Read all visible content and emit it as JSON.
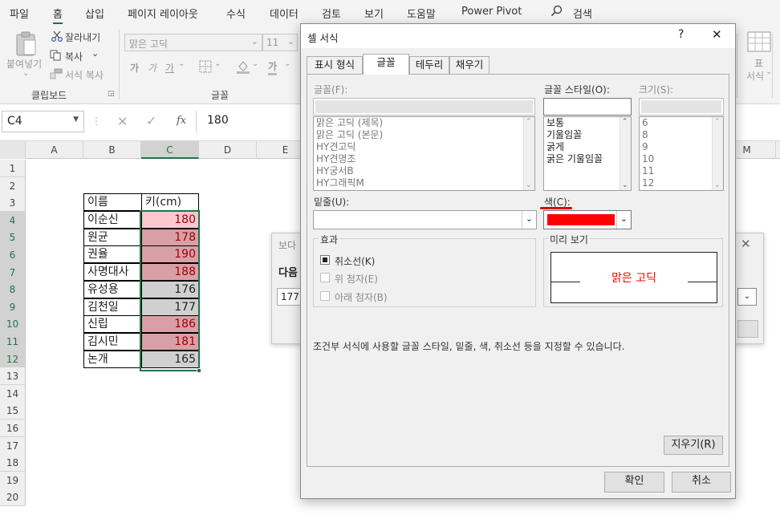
{
  "menu": {
    "items": [
      "파일",
      "홈",
      "삽입",
      "페이지 레이아웃",
      "수식",
      "데이터",
      "검토",
      "보기",
      "도움말",
      "Power Pivot"
    ],
    "search_label": "검색"
  },
  "ribbon": {
    "clipboard": {
      "paste": "붙여넣기",
      "cut": "잘라내기",
      "copy": "복사",
      "format_painter": "서식 복사",
      "group_label": "클립보드"
    },
    "font": {
      "font_name": "맑은 고딕",
      "font_size": "11",
      "bold": "가",
      "italic": "가",
      "underline": "가",
      "font_color": "가",
      "group_label": "글꼴"
    },
    "right": {
      "label1": "표",
      "label2": "서식"
    }
  },
  "formula_bar": {
    "name_box": "C4",
    "fx": "fx",
    "value": "180"
  },
  "grid": {
    "columns": [
      "A",
      "B",
      "C",
      "D",
      "E",
      "M"
    ],
    "rows": [
      "1",
      "2",
      "3",
      "4",
      "5",
      "6",
      "7",
      "8",
      "9",
      "10",
      "11",
      "12",
      "13",
      "14",
      "15",
      "16",
      "17",
      "18",
      "19",
      "20"
    ],
    "header": {
      "name": "이름",
      "height": "키(cm)"
    },
    "data": [
      {
        "name": "이순신",
        "height": "180",
        "hl": "#ffc7ce"
      },
      {
        "name": "원균",
        "height": "178",
        "hl": "#d8a0a6"
      },
      {
        "name": "권율",
        "height": "190",
        "hl": "#d8a0a6"
      },
      {
        "name": "사명대사",
        "height": "188",
        "hl": "#d8a0a6"
      },
      {
        "name": "유성용",
        "height": "176",
        "hl": "#d0d0d0"
      },
      {
        "name": "김천일",
        "height": "177",
        "hl": "#d0d0d0"
      },
      {
        "name": "신립",
        "height": "186",
        "hl": "#d8a0a6"
      },
      {
        "name": "김시민",
        "height": "181",
        "hl": "#d8a0a6"
      },
      {
        "name": "논개",
        "height": "165",
        "hl": "#d0d0d0"
      }
    ]
  },
  "bg_dialog": {
    "title": "보다",
    "prompt": "다음",
    "value": "177."
  },
  "dialog": {
    "title": "셀 서식",
    "help": "?",
    "close": "✕",
    "tabs": [
      "표시 형식",
      "글꼴",
      "테두리",
      "채우기"
    ],
    "font_label": "글꼴(F):",
    "fonts": [
      "맑은 고딕 (제목)",
      "맑은 고딕 (본문)",
      "HY견고딕",
      "HY견명조",
      "HY궁서B",
      "HY그래픽M"
    ],
    "style_label": "글꼴 스타일(O):",
    "styles": [
      "보통",
      "기울임꼴",
      "굵게",
      "굵은 기울임꼴"
    ],
    "size_label": "크기(S):",
    "sizes": [
      "6",
      "8",
      "9",
      "10",
      "11",
      "12"
    ],
    "underline_label": "밑줄(U):",
    "color_label": "색(C):",
    "color_value": "#ff0000",
    "effects_label": "효과",
    "strikethrough": "취소선(K)",
    "superscript": "위 첨자(E)",
    "subscript": "아래 첨자(B)",
    "preview_label": "미리 보기",
    "preview_text": "맑은 고딕",
    "info": "조건부 서식에 사용할 글꼴 스타일, 밑줄, 색, 취소선 등을 지정할 수 있습니다.",
    "clear": "지우기(R)",
    "ok": "확인",
    "cancel": "취소"
  }
}
